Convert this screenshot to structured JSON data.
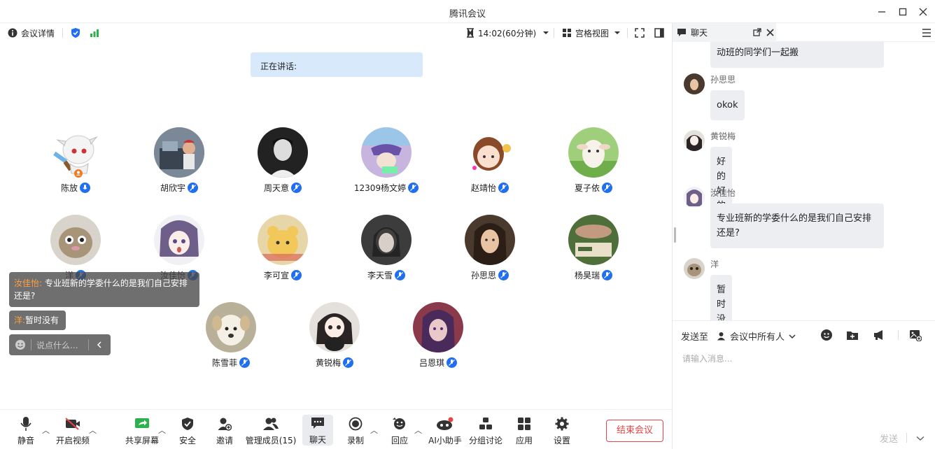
{
  "window": {
    "title": "腾讯会议"
  },
  "topbar": {
    "details_label": "会议详情",
    "timer": "14:02(60分钟)",
    "view_label": "宫格视图"
  },
  "stage": {
    "speaking_label": "正在讲话:",
    "participants": [
      {
        "name": "陈放"
      },
      {
        "name": "胡欣宇"
      },
      {
        "name": "周天意"
      },
      {
        "name": "12309杨文婷"
      },
      {
        "name": "赵靖怡"
      },
      {
        "name": "夏子依"
      },
      {
        "name": "洋"
      },
      {
        "name": "汝佳怡"
      },
      {
        "name": "李可宣"
      },
      {
        "name": "李天雪"
      },
      {
        "name": "孙思思"
      },
      {
        "name": "杨昊瑞"
      },
      {
        "name": "陈雪菲"
      },
      {
        "name": "黄锐梅"
      },
      {
        "name": "吕恩琪"
      }
    ]
  },
  "overlay": {
    "msg1_sender": "汝佳怡:",
    "msg1_text": "专业班新的学委什么的是我们自己安排还是?",
    "msg2_sender": "洋:",
    "msg2_text": "暂时没有",
    "input_placeholder": "说点什么..."
  },
  "bottombar": {
    "mute": "静音",
    "video": "开启视频",
    "share": "共享屏幕",
    "security": "安全",
    "invite": "邀请",
    "members": "管理成员(15)",
    "chat": "聊天",
    "record": "录制",
    "react": "回应",
    "ai": "AI小助手",
    "breakout": "分组讨论",
    "apps": "应用",
    "settings": "设置",
    "end": "结束会议"
  },
  "chat": {
    "tab_label": "聊天",
    "partial_text": "动班的同学们一起搬",
    "messages": [
      {
        "sender": "孙思思",
        "text": "okok"
      },
      {
        "sender": "黄锐梅",
        "text": "好的好的"
      },
      {
        "sender": "汝佳怡",
        "text": "专业班新的学委什么的是我们自己安排还是?"
      },
      {
        "sender": "洋",
        "text": "暂时没有"
      }
    ],
    "send_to_label": "发送至",
    "send_to_target": "会议中所有人",
    "input_placeholder": "请输入消息...",
    "send_button": "发送"
  },
  "colors": {
    "accent": "#1f6ff0",
    "end_red": "#e54545",
    "speaking_bg": "#d8e9fb",
    "green": "#2bb24c"
  }
}
